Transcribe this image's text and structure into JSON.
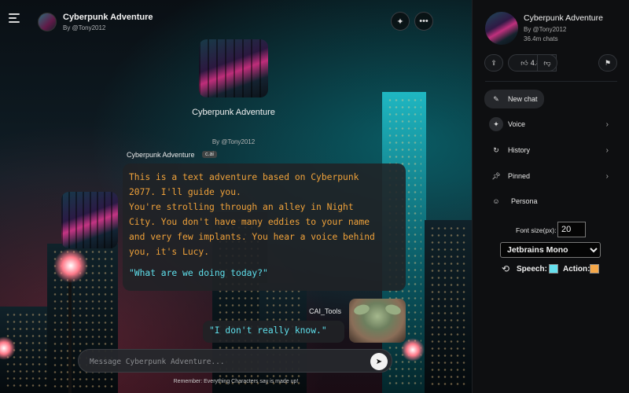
{
  "header": {
    "title": "Cyberpunk Adventure",
    "author": "By @Tony2012",
    "menu_icon": "hamburger-icon",
    "voice_icon": "voice-icon",
    "more_icon": "more-icon"
  },
  "intro": {
    "name": "Cyberpunk Adventure",
    "by": "By @Tony2012"
  },
  "messages": {
    "bot": {
      "name": "Cyberpunk Adventure",
      "badge": "c.ai",
      "text": "This is a text adventure based on Cyberpunk\n2077. I'll guide you.\nYou're strolling through an alley in Night\nCity. You don't have many eddies to your name\nand very few implants. You hear a voice behind\nyou, it's Lucy.",
      "quote": "\"What are we doing today?\""
    },
    "user": {
      "name": "CAI_Tools",
      "text": "\"I don't really know.\""
    }
  },
  "composer": {
    "placeholder": "Message Cyberpunk Adventure...",
    "send_icon": "send-icon"
  },
  "disclaimer": "Remember: Everything Characters say is made up!",
  "panel": {
    "title": "Cyberpunk Adventure",
    "author": "By @Tony2012",
    "chats": "36.4m chats",
    "likes": "4.8k",
    "share_icon": "share-icon",
    "like_icon": "thumbs-up-icon",
    "dislike_icon": "thumbs-down-icon",
    "flag_icon": "flag-icon",
    "nav": [
      {
        "label": "New chat",
        "icon": "edit-icon"
      },
      {
        "label": "Voice",
        "icon": "voice-icon"
      },
      {
        "label": "History",
        "icon": "history-icon"
      },
      {
        "label": "Pinned",
        "icon": "pin-icon"
      },
      {
        "label": "Persona",
        "icon": "persona-icon"
      }
    ],
    "font_size_label": "Font size(px):",
    "font_size_value": "20",
    "font_family": "Jetbrains Mono",
    "speech_label": "Speech:",
    "action_label": "Action:",
    "speech_color": "#66e0ee",
    "action_color": "#f5a84a"
  }
}
